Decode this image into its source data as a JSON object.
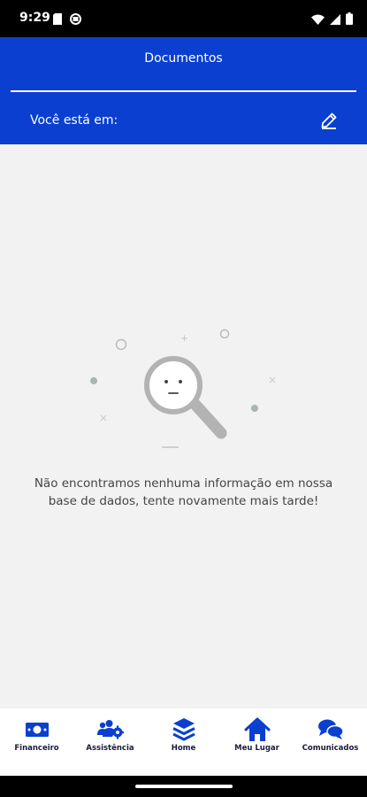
{
  "status_bar": {
    "time": "9:29",
    "icons": [
      "sim-card-icon",
      "app-notification-icon",
      "wifi-icon",
      "cell-signal-icon",
      "battery-icon"
    ]
  },
  "header": {
    "title": "Documentos",
    "location_label": "Você está em:",
    "edit_icon": "pencil-icon"
  },
  "empty_state": {
    "illustration": "magnifier-neutral-face",
    "message": "Não encontramos nenhuma informação em nossa base de dados, tente novamente mais tarde!"
  },
  "bottom_nav": {
    "items": [
      {
        "label": "Financeiro",
        "icon": "money-icon"
      },
      {
        "label": "Assistência",
        "icon": "people-gear-icon"
      },
      {
        "label": "Home",
        "icon": "layers-icon"
      },
      {
        "label": "Meu Lugar",
        "icon": "house-icon"
      },
      {
        "label": "Comunicados",
        "icon": "chat-bubbles-icon"
      }
    ]
  },
  "colors": {
    "primary": "#0a3fd0",
    "nav_icon": "#0a3fd0",
    "background": "#f2f2f2"
  }
}
